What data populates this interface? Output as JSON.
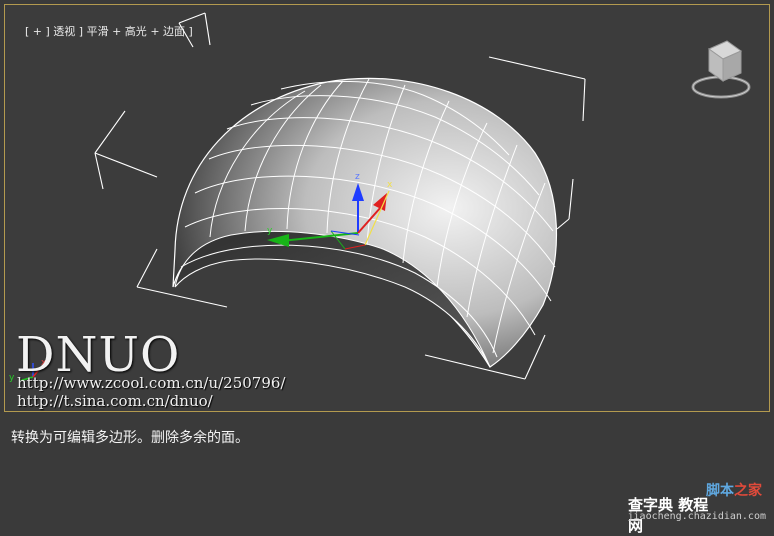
{
  "viewport": {
    "label_parts": [
      "[ + ]",
      "透视",
      "]",
      "平滑 + 高光",
      "+ 边面 ]"
    ],
    "axes": {
      "x": "x",
      "y": "y",
      "z": "z"
    },
    "colors": {
      "border": "#b39a4f",
      "background": "#3c3c3c",
      "wire": "#ffffff"
    }
  },
  "watermark": {
    "title": "DNUO",
    "url1": "http://www.zcool.com.cn/u/250796/",
    "url2": "http://t.sina.com.cn/dnuo/"
  },
  "caption": "转换为可编辑多边形。删除多余的面。",
  "site": {
    "line1_blue": "脚本",
    "line1_red": "之家",
    "line2": "查字典 教程网",
    "url": "jiaocheng.chazidian.com"
  }
}
